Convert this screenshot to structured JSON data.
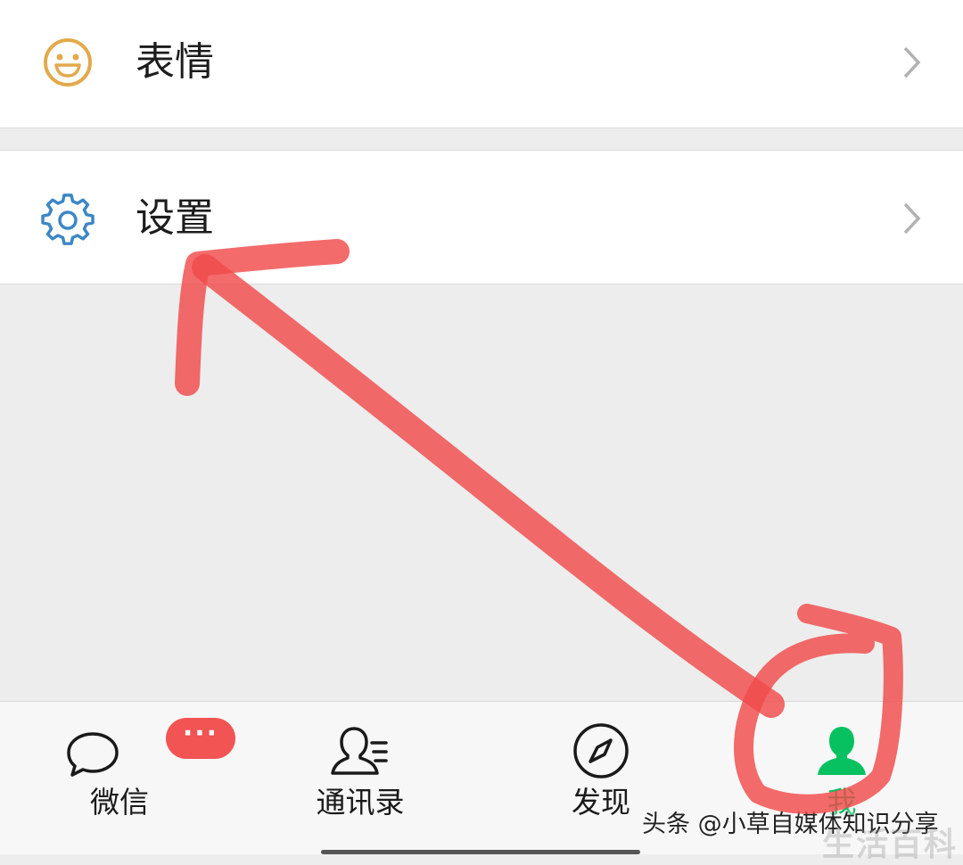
{
  "menu": {
    "stickers_label": "表情",
    "settings_label": "设置"
  },
  "tabbar": {
    "chats_label": "微信",
    "chats_badge": "···",
    "contacts_label": "通讯录",
    "discover_label": "发现",
    "me_label": "我"
  },
  "watermark": {
    "author": "头条 @小草自媒体知识分享",
    "site": "生活百科"
  },
  "icons": {
    "stickers": "smiley-icon",
    "settings": "gear-icon",
    "chats": "chat-bubble-icon",
    "contacts": "contacts-icon",
    "discover": "compass-icon",
    "me": "person-icon",
    "chevron": "chevron-right-icon"
  },
  "colors": {
    "accent_green": "#07c160",
    "badge_red": "#f25353",
    "stickers_icon": "#e3a94b",
    "settings_icon": "#3d86c6",
    "annotation_red": "#f04a4a"
  }
}
